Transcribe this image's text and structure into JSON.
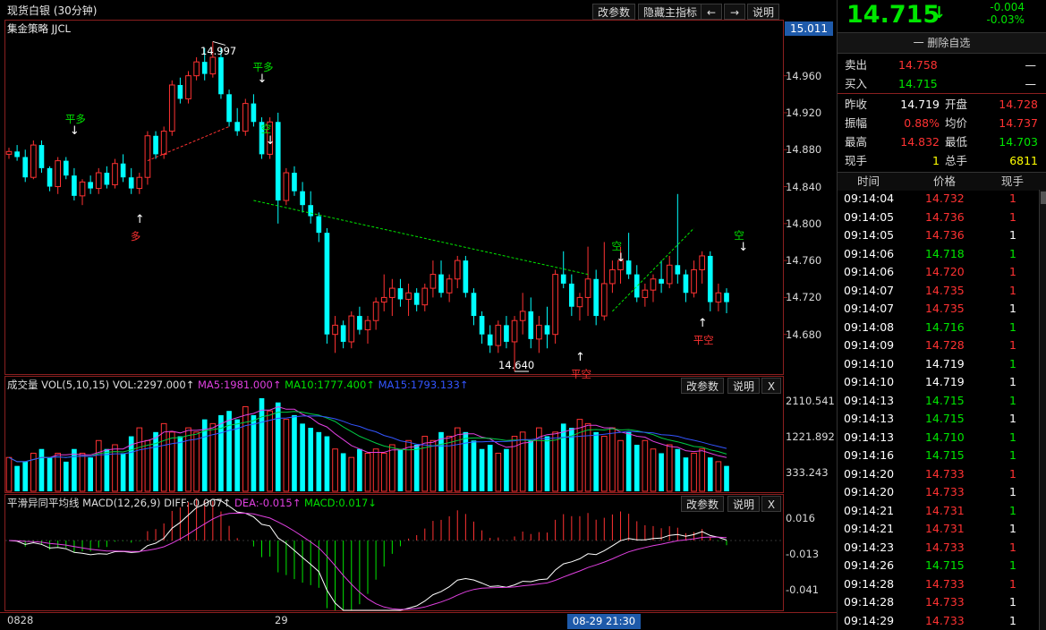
{
  "header": {
    "title": "现货白银 (30分钟)",
    "strategy": "集金策略 JJCL",
    "buttons": [
      "改参数",
      "隐藏主指标",
      "←",
      "→",
      "说明"
    ]
  },
  "main_chart": {
    "price_tag": "15.011",
    "y_ticks": [
      "14.960",
      "14.920",
      "14.880",
      "14.840",
      "14.800",
      "14.760",
      "14.720",
      "14.680"
    ],
    "high_label": "14.997",
    "low_label": "14.640",
    "annotations": [
      {
        "text": "平多",
        "color": "#00e600"
      },
      {
        "text": "多",
        "color": "#ff3232"
      },
      {
        "text": "平多",
        "color": "#00e600"
      },
      {
        "text": "空",
        "color": "#00e600"
      },
      {
        "text": "平空",
        "color": "#ff3232"
      },
      {
        "text": "空",
        "color": "#00e600"
      },
      {
        "text": "平空",
        "color": "#ff3232"
      },
      {
        "text": "空",
        "color": "#00e600"
      }
    ]
  },
  "volume_panel": {
    "name": "成交量",
    "params": "VOL(5,10,15)",
    "vol": "VOL:2297.000↑",
    "ma5": "MA5:1981.000↑",
    "ma10": "MA10:1777.400↑",
    "ma15": "MA15:1793.133↑",
    "y_ticks": [
      "2110.541",
      "1221.892",
      "333.243"
    ],
    "buttons": [
      "改参数",
      "说明",
      "X"
    ]
  },
  "macd_panel": {
    "name": "平滑异同平均线",
    "params": "MACD(12,26,9)",
    "diff": "DIFF:-0.007↑",
    "dea": "DEA:-0.015↑",
    "macd": "MACD:0.017↓",
    "y_ticks": [
      "0.016",
      "-0.013",
      "-0.041"
    ],
    "buttons": [
      "改参数",
      "说明",
      "X"
    ]
  },
  "x_axis": {
    "labels": [
      "0828",
      "29"
    ],
    "cursor_label": "08-29 21:30"
  },
  "quote": {
    "price": "14.715",
    "arrow": "↓",
    "change": "-0.004",
    "change_pct": "-0.03%",
    "watch_button": "一 删除自选",
    "sell_label": "卖出",
    "sell_price": "14.758",
    "sell_vol": "—",
    "buy_label": "买入",
    "buy_price": "14.715",
    "buy_vol": "—",
    "stats": [
      {
        "l1": "昨收",
        "v1": "14.719",
        "c1": "white",
        "l2": "开盘",
        "v2": "14.728",
        "c2": "red"
      },
      {
        "l1": "振幅",
        "v1": "0.88%",
        "c1": "red",
        "l2": "均价",
        "v2": "14.737",
        "c2": "red"
      },
      {
        "l1": "最高",
        "v1": "14.832",
        "c1": "red",
        "l2": "最低",
        "v2": "14.703",
        "c2": "green"
      },
      {
        "l1": "现手",
        "v1": "1",
        "c1": "yellow",
        "l2": "总手",
        "v2": "6811",
        "c2": "yellow"
      }
    ]
  },
  "ticks": {
    "headers": [
      "时间",
      "价格",
      "现手"
    ],
    "rows": [
      {
        "time": "09:14:04",
        "price": "14.732",
        "pc": "red",
        "vol": "1",
        "vc": "red"
      },
      {
        "time": "09:14:05",
        "price": "14.736",
        "pc": "red",
        "vol": "1",
        "vc": "red"
      },
      {
        "time": "09:14:05",
        "price": "14.736",
        "pc": "red",
        "vol": "1",
        "vc": "white"
      },
      {
        "time": "09:14:06",
        "price": "14.718",
        "pc": "green",
        "vol": "1",
        "vc": "green"
      },
      {
        "time": "09:14:06",
        "price": "14.720",
        "pc": "red",
        "vol": "1",
        "vc": "red"
      },
      {
        "time": "09:14:07",
        "price": "14.735",
        "pc": "red",
        "vol": "1",
        "vc": "red"
      },
      {
        "time": "09:14:07",
        "price": "14.735",
        "pc": "red",
        "vol": "1",
        "vc": "white"
      },
      {
        "time": "09:14:08",
        "price": "14.716",
        "pc": "green",
        "vol": "1",
        "vc": "green"
      },
      {
        "time": "09:14:09",
        "price": "14.728",
        "pc": "red",
        "vol": "1",
        "vc": "red"
      },
      {
        "time": "09:14:10",
        "price": "14.719",
        "pc": "white",
        "vol": "1",
        "vc": "green"
      },
      {
        "time": "09:14:10",
        "price": "14.719",
        "pc": "white",
        "vol": "1",
        "vc": "white"
      },
      {
        "time": "09:14:13",
        "price": "14.715",
        "pc": "green",
        "vol": "1",
        "vc": "green"
      },
      {
        "time": "09:14:13",
        "price": "14.715",
        "pc": "green",
        "vol": "1",
        "vc": "white"
      },
      {
        "time": "09:14:13",
        "price": "14.710",
        "pc": "green",
        "vol": "1",
        "vc": "green"
      },
      {
        "time": "09:14:16",
        "price": "14.715",
        "pc": "green",
        "vol": "1",
        "vc": "green"
      },
      {
        "time": "09:14:20",
        "price": "14.733",
        "pc": "red",
        "vol": "1",
        "vc": "red"
      },
      {
        "time": "09:14:20",
        "price": "14.733",
        "pc": "red",
        "vol": "1",
        "vc": "white"
      },
      {
        "time": "09:14:21",
        "price": "14.731",
        "pc": "red",
        "vol": "1",
        "vc": "green"
      },
      {
        "time": "09:14:21",
        "price": "14.731",
        "pc": "red",
        "vol": "1",
        "vc": "white"
      },
      {
        "time": "09:14:23",
        "price": "14.733",
        "pc": "red",
        "vol": "1",
        "vc": "red"
      },
      {
        "time": "09:14:26",
        "price": "14.715",
        "pc": "green",
        "vol": "1",
        "vc": "green"
      },
      {
        "time": "09:14:28",
        "price": "14.733",
        "pc": "red",
        "vol": "1",
        "vc": "red"
      },
      {
        "time": "09:14:28",
        "price": "14.733",
        "pc": "red",
        "vol": "1",
        "vc": "white"
      },
      {
        "time": "09:14:29",
        "price": "14.733",
        "pc": "red",
        "vol": "1",
        "vc": "white"
      }
    ]
  },
  "colors": {
    "up": "#ff3232",
    "down": "#00ffff",
    "ma5": "#ffffff",
    "ma10": "#d5d52a",
    "ma15": "#e040e0",
    "ma20": "#00cc44",
    "ma30": "#3355ff"
  },
  "chart_data": {
    "type": "candlestick",
    "ylim": [
      14.64,
      15.011
    ],
    "series": [
      {
        "o": 14.875,
        "h": 14.882,
        "l": 14.87,
        "c": 14.878
      },
      {
        "o": 14.878,
        "h": 14.885,
        "l": 14.868,
        "c": 14.872
      },
      {
        "o": 14.872,
        "h": 14.88,
        "l": 14.845,
        "c": 14.85
      },
      {
        "o": 14.85,
        "h": 14.89,
        "l": 14.848,
        "c": 14.885
      },
      {
        "o": 14.885,
        "h": 14.89,
        "l": 14.855,
        "c": 14.86
      },
      {
        "o": 14.86,
        "h": 14.862,
        "l": 14.835,
        "c": 14.84
      },
      {
        "o": 14.84,
        "h": 14.872,
        "l": 14.832,
        "c": 14.868
      },
      {
        "o": 14.868,
        "h": 14.872,
        "l": 14.848,
        "c": 14.852
      },
      {
        "o": 14.852,
        "h": 14.86,
        "l": 14.825,
        "c": 14.83
      },
      {
        "o": 14.83,
        "h": 14.848,
        "l": 14.82,
        "c": 14.845
      },
      {
        "o": 14.845,
        "h": 14.852,
        "l": 14.832,
        "c": 14.838
      },
      {
        "o": 14.838,
        "h": 14.86,
        "l": 14.832,
        "c": 14.855
      },
      {
        "o": 14.855,
        "h": 14.862,
        "l": 14.838,
        "c": 14.842
      },
      {
        "o": 14.842,
        "h": 14.87,
        "l": 14.838,
        "c": 14.865
      },
      {
        "o": 14.865,
        "h": 14.875,
        "l": 14.845,
        "c": 14.85
      },
      {
        "o": 14.85,
        "h": 14.86,
        "l": 14.832,
        "c": 14.838
      },
      {
        "o": 14.838,
        "h": 14.855,
        "l": 14.832,
        "c": 14.85
      },
      {
        "o": 14.85,
        "h": 14.9,
        "l": 14.842,
        "c": 14.895
      },
      {
        "o": 14.895,
        "h": 14.9,
        "l": 14.87,
        "c": 14.875
      },
      {
        "o": 14.875,
        "h": 14.905,
        "l": 14.87,
        "c": 14.9
      },
      {
        "o": 14.9,
        "h": 14.955,
        "l": 14.895,
        "c": 14.95
      },
      {
        "o": 14.95,
        "h": 14.958,
        "l": 14.93,
        "c": 14.935
      },
      {
        "o": 14.935,
        "h": 14.965,
        "l": 14.93,
        "c": 14.96
      },
      {
        "o": 14.96,
        "h": 14.98,
        "l": 14.955,
        "c": 14.975
      },
      {
        "o": 14.975,
        "h": 14.99,
        "l": 14.955,
        "c": 14.962
      },
      {
        "o": 14.962,
        "h": 14.997,
        "l": 14.958,
        "c": 14.98
      },
      {
        "o": 14.98,
        "h": 14.99,
        "l": 14.935,
        "c": 14.94
      },
      {
        "o": 14.94,
        "h": 14.945,
        "l": 14.905,
        "c": 14.91
      },
      {
        "o": 14.91,
        "h": 14.925,
        "l": 14.895,
        "c": 14.9
      },
      {
        "o": 14.9,
        "h": 14.935,
        "l": 14.895,
        "c": 14.93
      },
      {
        "o": 14.93,
        "h": 14.94,
        "l": 14.905,
        "c": 14.91
      },
      {
        "o": 14.91,
        "h": 14.915,
        "l": 14.87,
        "c": 14.875
      },
      {
        "o": 14.875,
        "h": 14.915,
        "l": 14.87,
        "c": 14.91
      },
      {
        "o": 14.91,
        "h": 14.92,
        "l": 14.8,
        "c": 14.825
      },
      {
        "o": 14.825,
        "h": 14.86,
        "l": 14.82,
        "c": 14.855
      },
      {
        "o": 14.855,
        "h": 14.862,
        "l": 14.83,
        "c": 14.835
      },
      {
        "o": 14.835,
        "h": 14.845,
        "l": 14.812,
        "c": 14.82
      },
      {
        "o": 14.82,
        "h": 14.835,
        "l": 14.8,
        "c": 14.808
      },
      {
        "o": 14.808,
        "h": 14.812,
        "l": 14.78,
        "c": 14.79
      },
      {
        "o": 14.79,
        "h": 14.795,
        "l": 14.67,
        "c": 14.68
      },
      {
        "o": 14.68,
        "h": 14.7,
        "l": 14.66,
        "c": 14.69
      },
      {
        "o": 14.69,
        "h": 14.695,
        "l": 14.665,
        "c": 14.672
      },
      {
        "o": 14.672,
        "h": 14.705,
        "l": 14.665,
        "c": 14.7
      },
      {
        "o": 14.7,
        "h": 14.71,
        "l": 14.68,
        "c": 14.685
      },
      {
        "o": 14.685,
        "h": 14.7,
        "l": 14.67,
        "c": 14.695
      },
      {
        "o": 14.695,
        "h": 14.72,
        "l": 14.685,
        "c": 14.715
      },
      {
        "o": 14.715,
        "h": 14.745,
        "l": 14.705,
        "c": 14.72
      },
      {
        "o": 14.72,
        "h": 14.74,
        "l": 14.7,
        "c": 14.73
      },
      {
        "o": 14.73,
        "h": 14.74,
        "l": 14.71,
        "c": 14.718
      },
      {
        "o": 14.718,
        "h": 14.735,
        "l": 14.7,
        "c": 14.725
      },
      {
        "o": 14.725,
        "h": 14.73,
        "l": 14.705,
        "c": 14.712
      },
      {
        "o": 14.712,
        "h": 14.735,
        "l": 14.705,
        "c": 14.73
      },
      {
        "o": 14.73,
        "h": 14.76,
        "l": 14.72,
        "c": 14.745
      },
      {
        "o": 14.745,
        "h": 14.76,
        "l": 14.72,
        "c": 14.725
      },
      {
        "o": 14.725,
        "h": 14.745,
        "l": 14.715,
        "c": 14.74
      },
      {
        "o": 14.74,
        "h": 14.765,
        "l": 14.73,
        "c": 14.76
      },
      {
        "o": 14.76,
        "h": 14.765,
        "l": 14.72,
        "c": 14.725
      },
      {
        "o": 14.725,
        "h": 14.73,
        "l": 14.69,
        "c": 14.7
      },
      {
        "o": 14.7,
        "h": 14.705,
        "l": 14.67,
        "c": 14.68
      },
      {
        "o": 14.68,
        "h": 14.69,
        "l": 14.66,
        "c": 14.668
      },
      {
        "o": 14.668,
        "h": 14.695,
        "l": 14.66,
        "c": 14.69
      },
      {
        "o": 14.69,
        "h": 14.7,
        "l": 14.665,
        "c": 14.672
      },
      {
        "o": 14.672,
        "h": 14.7,
        "l": 14.64,
        "c": 14.695
      },
      {
        "o": 14.695,
        "h": 14.725,
        "l": 14.68,
        "c": 14.705
      },
      {
        "o": 14.705,
        "h": 14.72,
        "l": 14.665,
        "c": 14.675
      },
      {
        "o": 14.675,
        "h": 14.7,
        "l": 14.66,
        "c": 14.69
      },
      {
        "o": 14.69,
        "h": 14.71,
        "l": 14.665,
        "c": 14.68
      },
      {
        "o": 14.68,
        "h": 14.75,
        "l": 14.67,
        "c": 14.745
      },
      {
        "o": 14.745,
        "h": 14.77,
        "l": 14.73,
        "c": 14.735
      },
      {
        "o": 14.735,
        "h": 14.745,
        "l": 14.7,
        "c": 14.71
      },
      {
        "o": 14.71,
        "h": 14.725,
        "l": 14.695,
        "c": 14.72
      },
      {
        "o": 14.72,
        "h": 14.775,
        "l": 14.7,
        "c": 14.74
      },
      {
        "o": 14.74,
        "h": 14.75,
        "l": 14.69,
        "c": 14.7
      },
      {
        "o": 14.7,
        "h": 14.78,
        "l": 14.695,
        "c": 14.735
      },
      {
        "o": 14.735,
        "h": 14.76,
        "l": 14.725,
        "c": 14.75
      },
      {
        "o": 14.75,
        "h": 14.775,
        "l": 14.735,
        "c": 14.76
      },
      {
        "o": 14.76,
        "h": 14.79,
        "l": 14.74,
        "c": 14.745
      },
      {
        "o": 14.745,
        "h": 14.755,
        "l": 14.715,
        "c": 14.72
      },
      {
        "o": 14.72,
        "h": 14.735,
        "l": 14.71,
        "c": 14.728
      },
      {
        "o": 14.728,
        "h": 14.745,
        "l": 14.715,
        "c": 14.74
      },
      {
        "o": 14.74,
        "h": 14.76,
        "l": 14.725,
        "c": 14.735
      },
      {
        "o": 14.735,
        "h": 14.765,
        "l": 14.73,
        "c": 14.755
      },
      {
        "o": 14.755,
        "h": 14.832,
        "l": 14.735,
        "c": 14.745
      },
      {
        "o": 14.745,
        "h": 14.75,
        "l": 14.715,
        "c": 14.725
      },
      {
        "o": 14.725,
        "h": 14.76,
        "l": 14.72,
        "c": 14.75
      },
      {
        "o": 14.75,
        "h": 14.77,
        "l": 14.735,
        "c": 14.765
      },
      {
        "o": 14.765,
        "h": 14.77,
        "l": 14.705,
        "c": 14.715
      },
      {
        "o": 14.715,
        "h": 14.735,
        "l": 14.705,
        "c": 14.725
      },
      {
        "o": 14.725,
        "h": 14.73,
        "l": 14.703,
        "c": 14.715
      }
    ]
  }
}
